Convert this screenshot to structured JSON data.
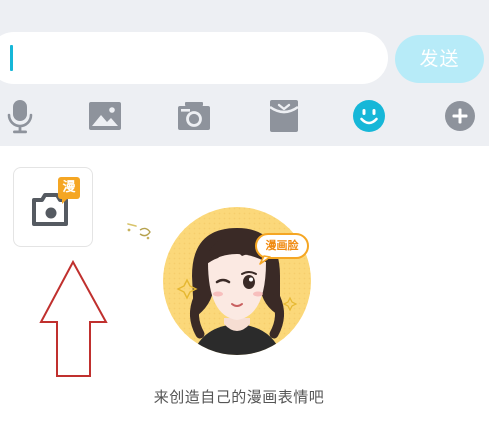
{
  "input": {
    "value": ""
  },
  "send_label": "发送",
  "toolbar": {
    "icons": [
      "microphone-icon",
      "image-icon",
      "camera-icon",
      "red-envelope-icon",
      "emoji-icon",
      "plus-icon"
    ],
    "active": "emoji-icon"
  },
  "emoji_panel": {
    "create_tile_badge": "漫",
    "avatar_bubble": "漫画脸",
    "caption": "来创造自己的漫画表情吧"
  },
  "colors": {
    "accent": "#16b7d8",
    "send_button": "#b7ebf8",
    "toolbar_bg": "#edeff3",
    "icon_gray": "#8e939c",
    "badge_orange": "#f5a623",
    "annotation_red": "#c0302e"
  }
}
